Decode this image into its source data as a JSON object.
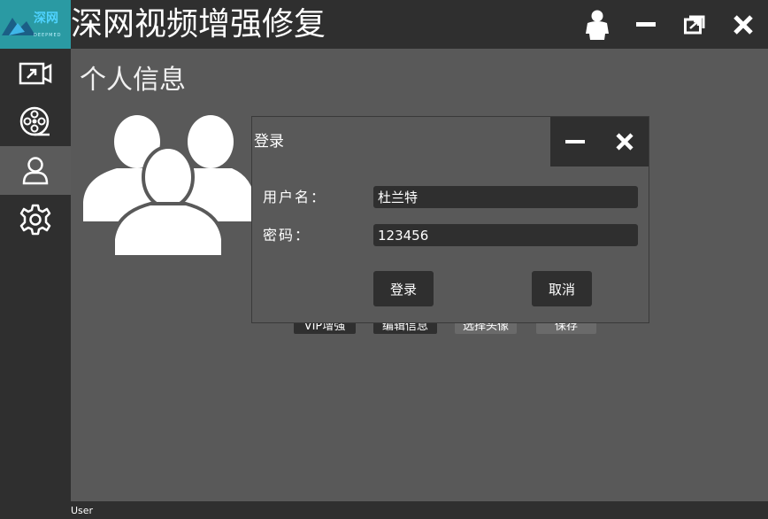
{
  "app": {
    "title": "深网视频增强修复",
    "logo_text": "深网",
    "logo_subtext": "DEEPMED"
  },
  "titlebar": {
    "buttons": [
      {
        "name": "user-button",
        "icon": "user-icon"
      },
      {
        "name": "minimize-button",
        "icon": "minimize-icon"
      },
      {
        "name": "restore-button",
        "icon": "restore-icon"
      },
      {
        "name": "close-button",
        "icon": "close-icon"
      }
    ]
  },
  "sidebar": {
    "items": [
      {
        "icon": "video-import-icon",
        "active": false
      },
      {
        "icon": "film-reel-icon",
        "active": false
      },
      {
        "icon": "user-profile-icon",
        "active": true
      },
      {
        "icon": "gear-icon",
        "active": false
      }
    ]
  },
  "page": {
    "title": "个人信息"
  },
  "profile_actions": [
    "VIP增强",
    "编辑信息",
    "选择头像",
    "保存"
  ],
  "status_bar": {
    "text": "User"
  },
  "login_dialog": {
    "title": "登录",
    "username_label": "用户名：",
    "username_value": "杜兰特",
    "password_label": "密码：",
    "password_value": "123456",
    "login_button": "登录",
    "cancel_button": "取消"
  },
  "colors": {
    "titlebar_bg": "#2f2f2f",
    "content_bg": "#595959",
    "logo_bg": "#2a9aa3",
    "active_sidebar_bg": "#5b5b5b",
    "text": "#ffffff"
  }
}
